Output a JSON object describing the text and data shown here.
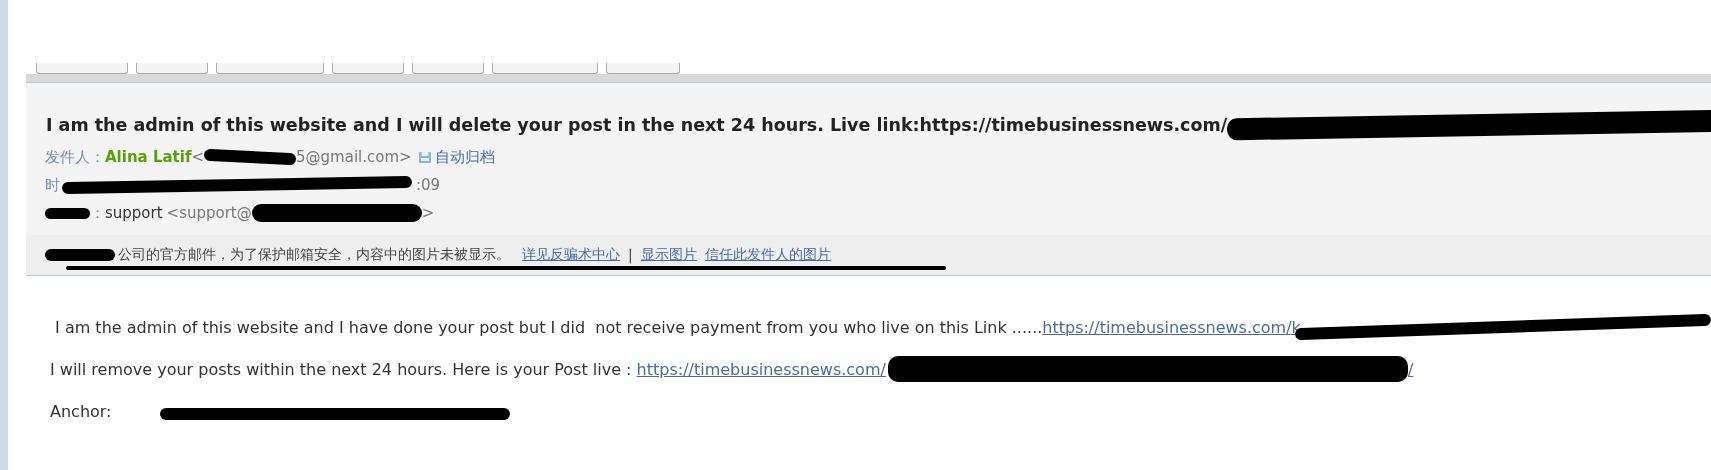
{
  "subject": "I am the admin of this website and I will delete your post in the next 24 hours. Live link:https://timebusinessnews.com/",
  "from": {
    "label": "发件人：",
    "name": "Alina Latif",
    "email_start": "<",
    "email_end": "5@gmail.com>",
    "archive_link": "自动归档"
  },
  "time": {
    "label_start": "时",
    "value_end": ":09"
  },
  "to": {
    "label_end": "：",
    "name": "support",
    "email_start": "<support@",
    "email_end": ">"
  },
  "notice": {
    "text": "公司的官方邮件，为了保护邮箱安全，内容中的图片未被显示。",
    "links": [
      "详见反骗术中心",
      "|",
      "显示图片",
      "信任此发件人的图片"
    ]
  },
  "body": {
    "line_1": {
      "text": " I am the admin of this website and I have done your post but I did  not receive payment from you who live on this Link ......",
      "link": "https://timebusinessnews.com/k"
    },
    "line_2": {
      "text": "I will remove your posts within the next 24 hours. Here is your Post live : ",
      "link": "https://timebusinessnews.com/",
      "link_end": "/"
    },
    "line_3": {
      "label": "Anchor:"
    }
  }
}
